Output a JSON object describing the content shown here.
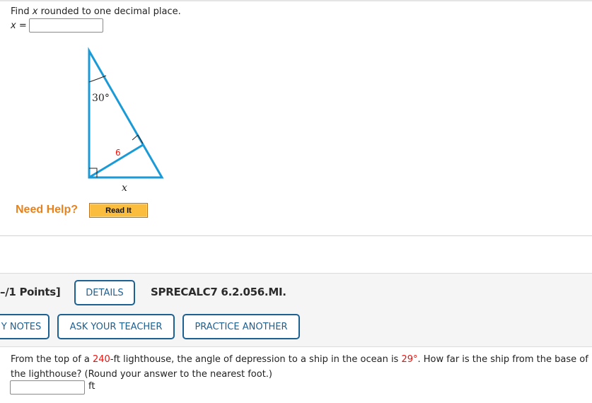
{
  "problem1": {
    "prompt_prefix": "Find ",
    "prompt_var": "x",
    "prompt_suffix": " rounded to one decimal place.",
    "answer_label_var": "x",
    "answer_label_eq": " =",
    "answer_value": "",
    "figure": {
      "angle_label": "30°",
      "altitude_label": "6",
      "base_label": "x",
      "line_color": "#1a9ad6",
      "altitude_label_color": "#e8130e"
    },
    "help": {
      "label": "Need Help?",
      "read_it_button": "Read It"
    }
  },
  "problem2": {
    "points_label": "–/1 Points]",
    "details_button": "DETAILS",
    "question_id": "SPRECALC7 6.2.056.MI.",
    "notes_button": "Y NOTES",
    "ask_teacher_button": "ASK YOUR TEACHER",
    "practice_another_button": "PRACTICE ANOTHER",
    "question": {
      "part1": "From the top of a ",
      "height_value": "240",
      "part2": "-ft lighthouse, the angle of depression to a ship in the ocean is ",
      "angle_value": "29°",
      "part3": ". How far is the ship from the base of the lighthouse? (Round your answer to the nearest foot.)"
    },
    "answer_value": "",
    "answer_unit": "ft"
  },
  "colors": {
    "accent_blue": "#1d6193",
    "help_orange": "#e8821d",
    "button_gold": "#fbbd3e",
    "highlight_red": "#e8130e",
    "band_gray": "#f5f5f5"
  }
}
